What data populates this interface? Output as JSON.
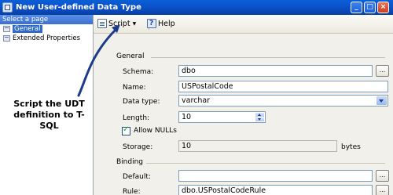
{
  "window": {
    "title": "New User-defined Data Type"
  },
  "left_pane": {
    "header": "Select a page",
    "items": [
      {
        "label": "General",
        "selected": true
      },
      {
        "label": "Extended Properties",
        "selected": false
      }
    ]
  },
  "toolbar": {
    "script_label": "Script",
    "help_label": "Help"
  },
  "general": {
    "section_title": "General",
    "schema": {
      "label": "Schema:",
      "value": "dbo"
    },
    "name": {
      "label": "Name:",
      "value": "USPostalCode"
    },
    "data_type": {
      "label": "Data type:",
      "value": "varchar"
    },
    "length": {
      "label": "Length:",
      "value": "10"
    },
    "allow_nulls": {
      "label": "Allow NULLs",
      "checked": true
    },
    "storage": {
      "label": "Storage:",
      "value": "10",
      "unit": "bytes"
    }
  },
  "binding": {
    "section_title": "Binding",
    "default": {
      "label": "Default:",
      "value": ""
    },
    "rule": {
      "label": "Rule:",
      "value": "dbo.USPostalCodeRule"
    }
  },
  "ellipsis_label": "...",
  "callout": {
    "line1": "Script the UDT",
    "line2": "definition to T-SQL"
  }
}
